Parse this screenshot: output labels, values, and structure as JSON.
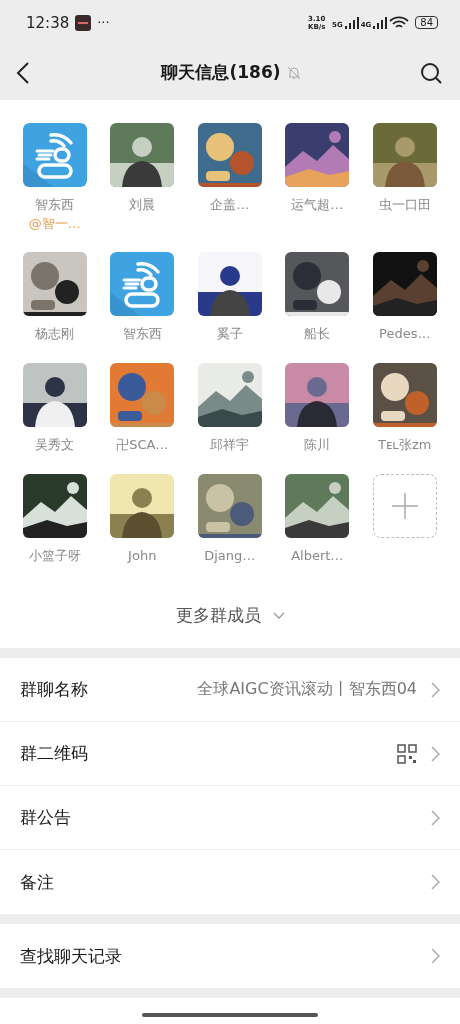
{
  "status_bar": {
    "time": "12:38",
    "more": "···",
    "speed": "3.10 KB/s",
    "net1": "5G",
    "net2": "4G",
    "battery": "84"
  },
  "nav": {
    "title": "聊天信息(186)",
    "muted": true
  },
  "members": [
    {
      "kind": "logo",
      "name": "智东西",
      "sub": "@智一…"
    },
    {
      "kind": "picture",
      "name": "刘晨"
    },
    {
      "kind": "picture",
      "name": "企盖…"
    },
    {
      "kind": "picture",
      "name": "运气超…"
    },
    {
      "kind": "picture",
      "name": "虫一口田"
    },
    {
      "kind": "picture",
      "name": "杨志刚"
    },
    {
      "kind": "logo",
      "name": "智东西"
    },
    {
      "kind": "picture",
      "name": "奚子"
    },
    {
      "kind": "picture",
      "name": "船长"
    },
    {
      "kind": "picture",
      "name": "Pedes…"
    },
    {
      "kind": "picture",
      "name": "吴秀文"
    },
    {
      "kind": "picture",
      "name": "卍SCA…"
    },
    {
      "kind": "picture",
      "name": "邱祥宇"
    },
    {
      "kind": "picture",
      "name": "陈川"
    },
    {
      "kind": "picture",
      "name": "Tᴇʟ张zm"
    },
    {
      "kind": "picture",
      "name": "小篮子呀"
    },
    {
      "kind": "picture",
      "name": "John"
    },
    {
      "kind": "picture",
      "name": "Djang…"
    },
    {
      "kind": "picture",
      "name": "Albert…"
    },
    {
      "kind": "add"
    }
  ],
  "more_members": "更多群成员",
  "groups": [
    [
      {
        "label": "群聊名称",
        "value": "全球AIGC资讯滚动丨智东西04"
      },
      {
        "label": "群二维码",
        "qr": true
      },
      {
        "label": "群公告"
      },
      {
        "label": "备注"
      }
    ],
    [
      {
        "label": "查找聊天记录"
      }
    ]
  ]
}
